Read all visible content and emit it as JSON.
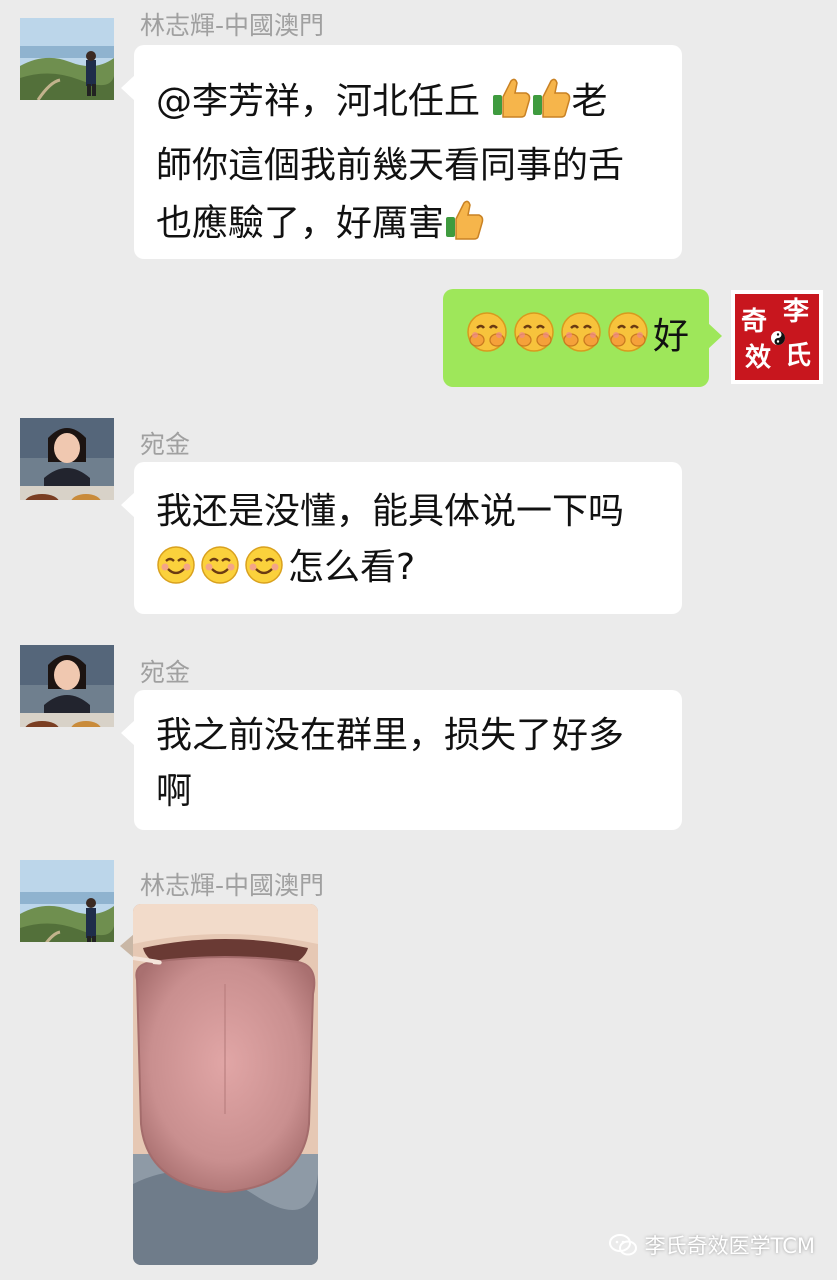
{
  "messages": [
    {
      "sender": "林志輝-中國澳門",
      "text_parts": [
        "@李芳祥，河北任丘 ",
        "老",
        "師你這個我前幾天看同事的舌",
        "也應驗了，好厲害"
      ]
    },
    {
      "text": "好"
    },
    {
      "sender": "宛金",
      "line1": "我还是没懂，能具体说一下吗",
      "line2": "怎么看?"
    },
    {
      "sender": "宛金",
      "line1": "我之前没在群里，损失了好多",
      "line2": "啊"
    },
    {
      "sender": "林志輝-中國澳門",
      "image": "tongue-photo"
    }
  ],
  "brand_avatar": {
    "chars": [
      "奇",
      "李",
      "效",
      "氏"
    ]
  },
  "watermark": {
    "text": "李氏奇效医学TCM",
    "icon": "wechat-icon"
  },
  "colors": {
    "background": "#ebebeb",
    "incoming_bubble": "#ffffff",
    "outgoing_bubble": "#9ee75a",
    "sender_name": "#a0a0a0",
    "brand_red": "#c8161e"
  }
}
